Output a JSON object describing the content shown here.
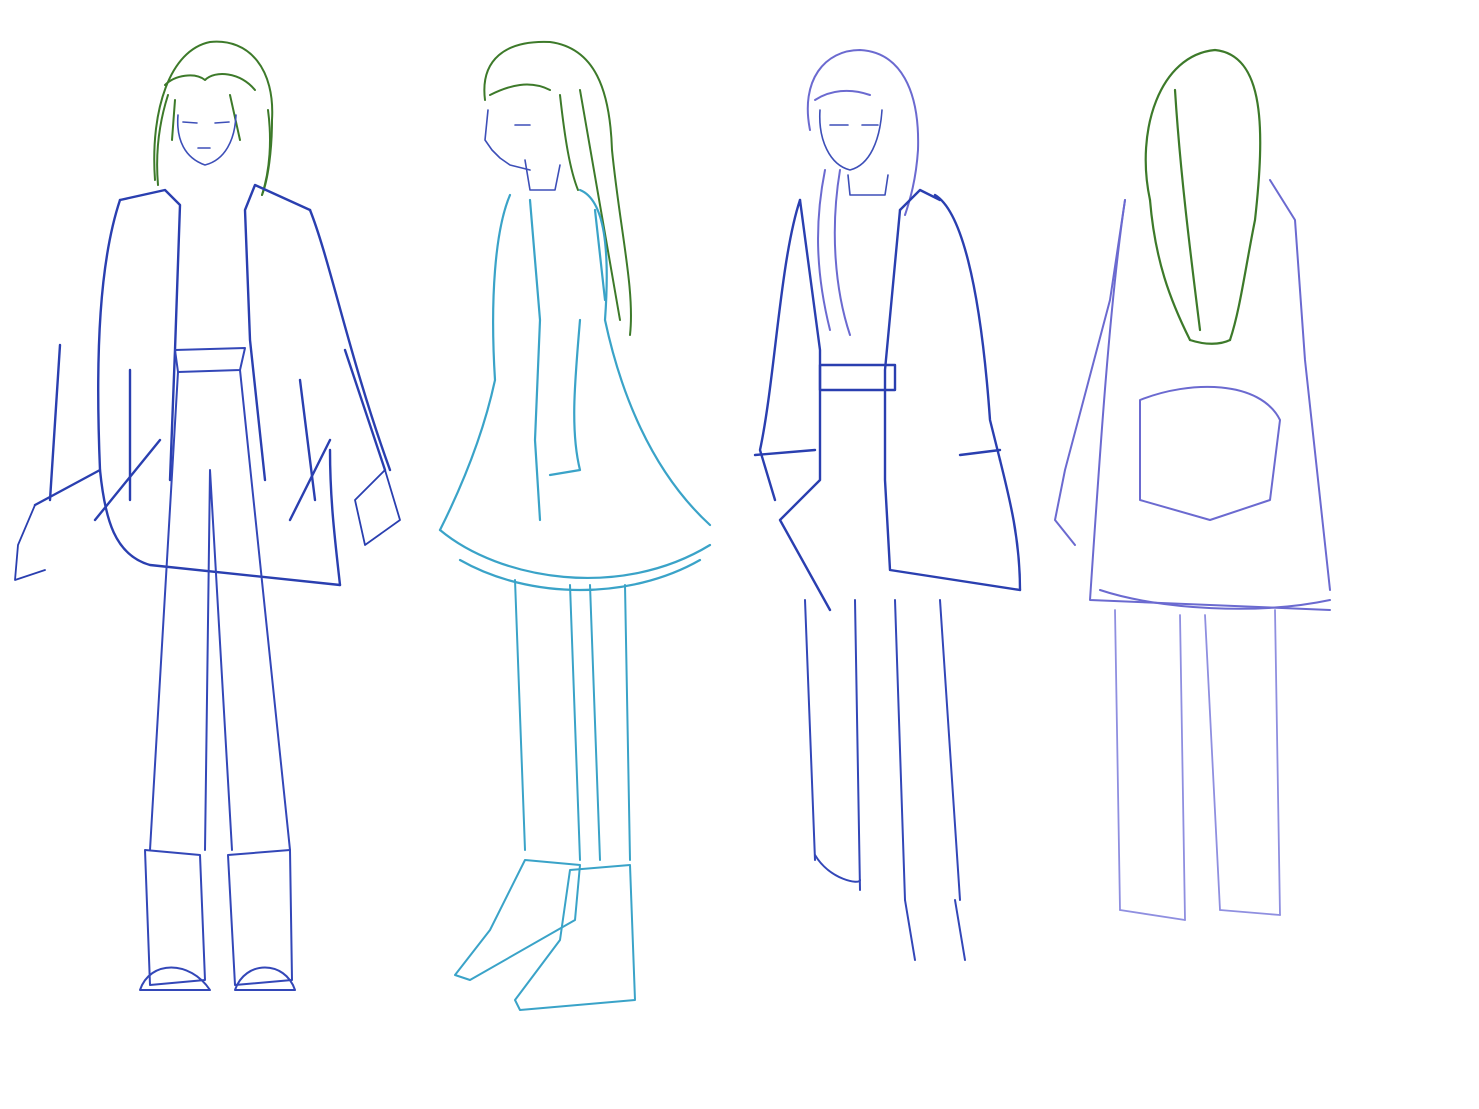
{
  "palette": {
    "hair_green": "#3d7a2a",
    "navy": "#2a3fb0",
    "cyan": "#3aa3c8",
    "violet": "#6b6ad0",
    "light_violet": "#8f8fe0",
    "paper": "#ffffff"
  },
  "figures": [
    {
      "name": "front-view",
      "color": "navy"
    },
    {
      "name": "side-view",
      "color": "cyan"
    },
    {
      "name": "three-quarter-view",
      "color": "violet"
    },
    {
      "name": "back-view",
      "color": "light_violet"
    }
  ]
}
